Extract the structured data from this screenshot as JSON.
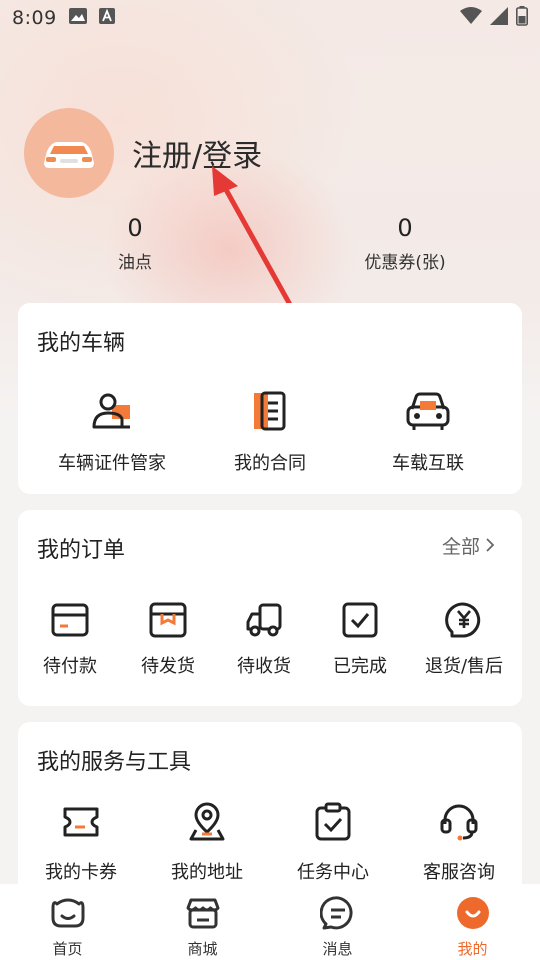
{
  "status_bar": {
    "time": "8:09"
  },
  "profile": {
    "login_label": "注册/登录"
  },
  "stats": [
    {
      "value": "0",
      "label": "油点"
    },
    {
      "value": "0",
      "label": "优惠券(张)"
    }
  ],
  "vehicles": {
    "title": "我的车辆",
    "items": [
      {
        "label": "车辆证件管家",
        "icon": "id-card-icon"
      },
      {
        "label": "我的合同",
        "icon": "contract-icon"
      },
      {
        "label": "车载互联",
        "icon": "car-connect-icon"
      }
    ]
  },
  "orders": {
    "title": "我的订单",
    "more": "全部",
    "items": [
      {
        "label": "待付款",
        "icon": "wallet-icon"
      },
      {
        "label": "待发货",
        "icon": "box-icon"
      },
      {
        "label": "待收货",
        "icon": "truck-icon"
      },
      {
        "label": "已完成",
        "icon": "check-icon"
      },
      {
        "label": "退货/售后",
        "icon": "refund-icon"
      }
    ]
  },
  "services": {
    "title": "我的服务与工具",
    "items": [
      {
        "label": "我的卡券",
        "icon": "ticket-icon"
      },
      {
        "label": "我的地址",
        "icon": "location-icon"
      },
      {
        "label": "任务中心",
        "icon": "task-icon"
      },
      {
        "label": "客服咨询",
        "icon": "headset-icon"
      }
    ]
  },
  "tabbar": {
    "items": [
      {
        "label": "首页",
        "icon": "home-icon"
      },
      {
        "label": "商城",
        "icon": "store-icon"
      },
      {
        "label": "消息",
        "icon": "message-icon"
      },
      {
        "label": "我的",
        "icon": "profile-icon",
        "active": true
      }
    ]
  },
  "colors": {
    "accent": "#ee6a2c",
    "annotation_arrow": "#e53935"
  }
}
